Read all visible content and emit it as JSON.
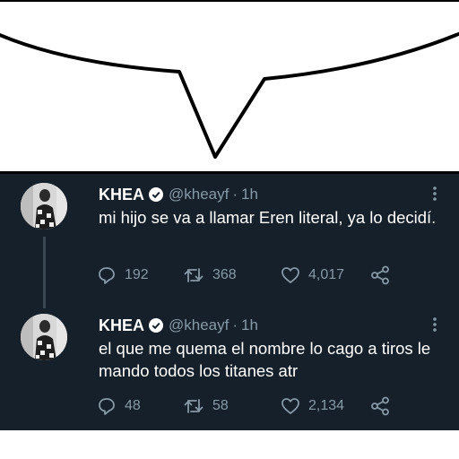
{
  "tweets": [
    {
      "name": "KHEA",
      "handle": "@kheayf",
      "separator": "·",
      "time": "1h",
      "text": "mi hijo se va a llamar Eren literal, ya lo decidí.",
      "replies": "192",
      "retweets": "368",
      "likes": "4,017"
    },
    {
      "name": "KHEA",
      "handle": "@kheayf",
      "separator": "·",
      "time": "1h",
      "text": "el que me quema el nombre lo cago a tiros le mando todos los titanes atr",
      "replies": "48",
      "retweets": "58",
      "likes": "2,134"
    }
  ],
  "icons": {
    "verified": "verified-badge-icon",
    "more": "more-options-icon",
    "reply": "reply-icon",
    "retweet": "retweet-icon",
    "like": "heart-icon",
    "share": "share-icon"
  },
  "colors": {
    "background": "#15202b",
    "text": "#ffffff",
    "muted": "#8899a6"
  }
}
